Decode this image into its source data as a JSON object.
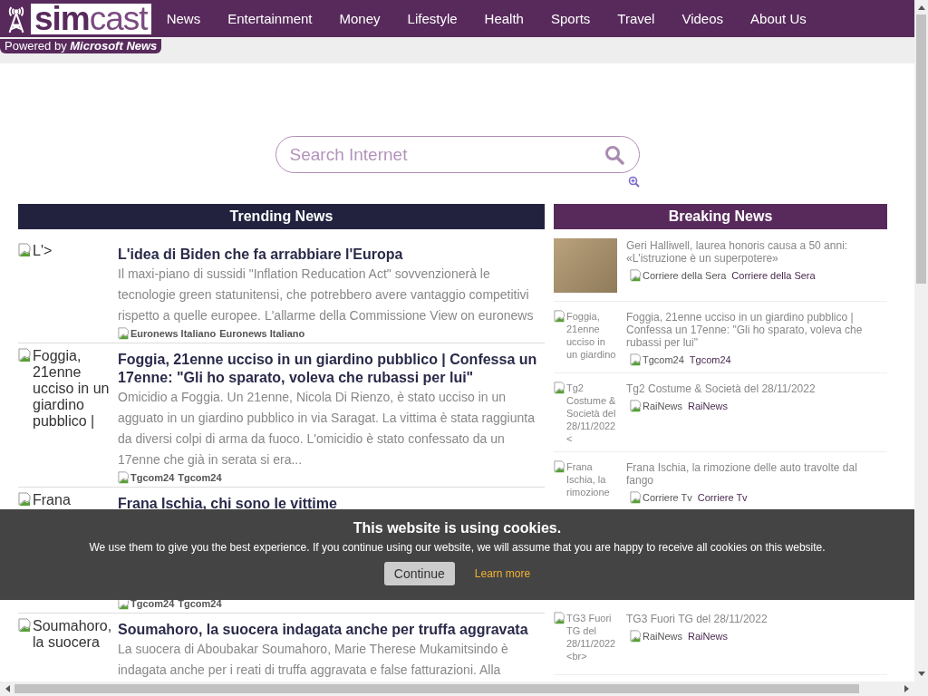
{
  "header": {
    "logo": {
      "part_1": "sim",
      "part_2": "cast"
    },
    "powered_by": "Powered by **Microsoft News**",
    "nav": [
      "News",
      "Entertainment",
      "Money",
      "Lifestyle",
      "Health",
      "Sports",
      "Travel",
      "Videos",
      "About Us"
    ]
  },
  "search": {
    "placeholder": "Search Internet"
  },
  "trending": {
    "title": "Trending News",
    "items": [
      {
        "image_alt": "L'>",
        "title": "L'idea di Biden che fa arrabbiare l'Europa",
        "summary": "Il maxi-piano di sussidi \"Inflation Reducation Act\" sovvenzionerà le tecnologie green statunitensi, che potrebbero avere vantaggio competitivi rispetto a quelle europee. L'allarme della Commissione View on euronews",
        "source_logo_alt": "Euronews Italiano",
        "source": "Euronews Italiano"
      },
      {
        "image_alt": "Foggia, 21enne ucciso in un giardino pubblico |",
        "title": "Foggia, 21enne ucciso in un giardino pubblico | Confessa un 17enne: \"Gli ho sparato, voleva che rubassi per lui\"",
        "summary": "Omicidio a Foggia. Un 21enne, Nicola Di Rienzo, è stato ucciso in un agguato in un giardino pubblico in via Saragat. La vittima è stata raggiunta da diversi colpi di arma da fuoco. L'omicidio è stato confessato da un 17enne che già in serata si era...",
        "source_logo_alt": "Tgcom24",
        "source": "Tgcom24"
      },
      {
        "image_alt": "Frana",
        "title": "Frana Ischia, chi sono le vittime",
        "source_logo_alt": "Tgcom24",
        "source": "Tgcom24"
      },
      {
        "image_alt": "Soumahoro, la suocera",
        "title": "Soumahoro, la suocera indagata anche per truffa aggravata",
        "summary": "La suocera di Aboubakar Soumahoro, Marie Therese Mukamitsindo è indagata anche per i reati di truffa aggravata e false fatturazioni. Alla"
      }
    ]
  },
  "breaking": {
    "title": "Breaking News",
    "items": [
      {
        "kind": "photo",
        "title": "Geri Halliwell, laurea honoris causa a 50 anni: «L'istruzione è un superpotere»",
        "source_logo_alt": "Corriere della Sera",
        "source": "Corriere della Sera"
      },
      {
        "kind": "broken-image",
        "image_alt": "Foggia, 21enne ucciso in un giardino",
        "title": "Foggia, 21enne ucciso in un giardino pubblico | Confessa un 17enne: \"Gli ho sparato, voleva che rubassi per lui\"",
        "source_logo_alt": "Tgcom24",
        "source": "Tgcom24"
      },
      {
        "kind": "broken-image",
        "image_alt": "Tg2 Costume & Società del 28/11/2022<",
        "title": "Tg2 Costume & Società del 28/11/2022",
        "source_logo_alt": "RaiNews",
        "source": "RaiNews"
      },
      {
        "kind": "broken-image",
        "image_alt": "Frana Ischia, la rimozione",
        "title": "Frana Ischia, la rimozione delle auto travolte dal fango",
        "source_logo_alt": "Corriere Tv",
        "source": "Corriere Tv"
      },
      {
        "kind": "broken-image",
        "image_alt": "TG3 Fuori TG del 28/11/2022<br>",
        "title": "TG3 Fuori TG del 28/11/2022",
        "source_logo_alt": "RaiNews",
        "source": "RaiNews"
      }
    ]
  },
  "cookie_banner": {
    "title": "This website is using cookies.",
    "message": "We use them to give you the best experience. If you continue using our website, we will assume that you are happy to receive all cookies on this website.",
    "continue_button": "Continue",
    "learn_more_link": "Learn more"
  }
}
